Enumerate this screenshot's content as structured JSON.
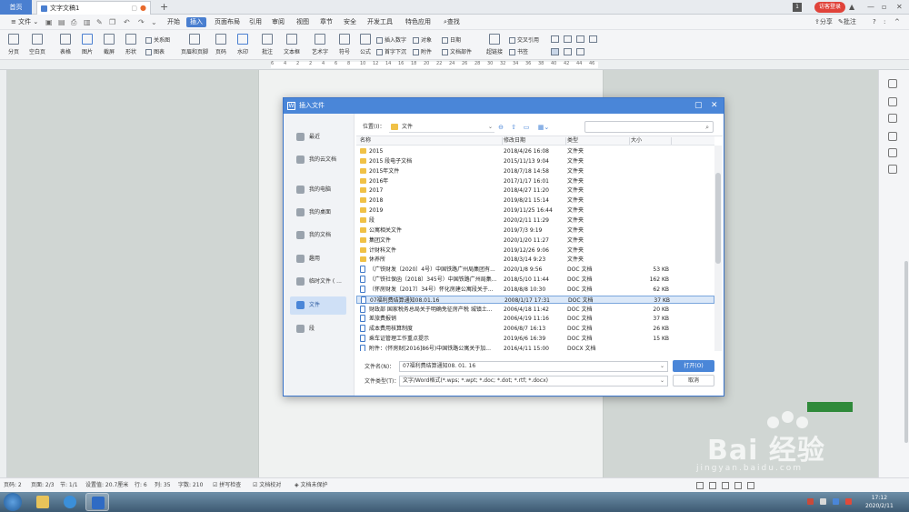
{
  "tabbar": {
    "home": "首页",
    "doc_tab": "文字文稿1",
    "new_tab": "+",
    "page_badge": "1",
    "login": "访客登录"
  },
  "menubar": {
    "file": "≡ 文件 ⌄",
    "menus": [
      "开始",
      "插入",
      "页面布局",
      "引用",
      "审阅",
      "视图",
      "章节",
      "安全",
      "开发工具",
      "特色应用",
      "查找"
    ],
    "active_menu": "插入",
    "share": "分享",
    "annotate": "批注",
    "help": "?",
    "more": ":",
    "collapse": "^"
  },
  "ribbon": {
    "items": [
      "分页",
      "空白页",
      "表格",
      "图片",
      "截屏",
      "形状",
      "关系图",
      "图表",
      "页眉和页脚",
      "页码",
      "水印",
      "批注",
      "文本框",
      "艺术字",
      "符号",
      "公式",
      "插入数字",
      "对象",
      "日期",
      "首字下沉",
      "附件",
      "文档部件",
      "超链接",
      "交叉引用",
      "书签"
    ]
  },
  "ruler": {
    "ticks": [
      "6",
      "4",
      "2",
      "2",
      "4",
      "6",
      "8",
      "10",
      "12",
      "14",
      "16",
      "18",
      "20",
      "22",
      "24",
      "26",
      "28",
      "30",
      "32",
      "34",
      "36",
      "38",
      "40",
      "42",
      "44",
      "46"
    ]
  },
  "dialog": {
    "title": "插入文件",
    "location_label": "位置(I)：",
    "location_value": "文件",
    "search_placeholder": "",
    "places": [
      "最近",
      "我的云文档",
      "我的电脑",
      "我的桌面",
      "我的文档",
      "趣用",
      "临时文件 ( ...",
      "文件",
      "段"
    ],
    "active_place": "文件",
    "columns": [
      "名称",
      "修改日期",
      "类型",
      "大小"
    ],
    "files": [
      {
        "name": "2015",
        "date": "2018/4/26 16:08",
        "type": "文件夹",
        "size": "",
        "kind": "folder"
      },
      {
        "name": "2015 段电子文档",
        "date": "2015/11/13 9:04",
        "type": "文件夹",
        "size": "",
        "kind": "folder"
      },
      {
        "name": "2015年文件",
        "date": "2018/7/18 14:58",
        "type": "文件夹",
        "size": "",
        "kind": "folder"
      },
      {
        "name": "2016年",
        "date": "2017/1/17 16:01",
        "type": "文件夹",
        "size": "",
        "kind": "folder"
      },
      {
        "name": "2017",
        "date": "2018/4/27 11:20",
        "type": "文件夹",
        "size": "",
        "kind": "folder"
      },
      {
        "name": "2018",
        "date": "2019/8/21 15:14",
        "type": "文件夹",
        "size": "",
        "kind": "folder"
      },
      {
        "name": "2019",
        "date": "2019/11/25 16:44",
        "type": "文件夹",
        "size": "",
        "kind": "folder"
      },
      {
        "name": "段",
        "date": "2020/2/11 11:29",
        "type": "文件夹",
        "size": "",
        "kind": "folder"
      },
      {
        "name": "公寓相关文件",
        "date": "2019/7/3 9:19",
        "type": "文件夹",
        "size": "",
        "kind": "folder"
      },
      {
        "name": "集团文件",
        "date": "2020/1/20 11:27",
        "type": "文件夹",
        "size": "",
        "kind": "folder"
      },
      {
        "name": "计财科文件",
        "date": "2019/12/26 9:06",
        "type": "文件夹",
        "size": "",
        "kind": "folder"
      },
      {
        "name": "休养所",
        "date": "2018/3/14 9:23",
        "type": "文件夹",
        "size": "",
        "kind": "folder"
      },
      {
        "name": "（广铁财发〔2020〕4号）中国铁路广州局集团有...",
        "date": "2020/1/8 9:56",
        "type": "DOC 文档",
        "size": "53 KB",
        "kind": "doc"
      },
      {
        "name": "（广铁社保函〔2018〕345号）中国铁路广州局集...",
        "date": "2018/5/10 11:44",
        "type": "DOC 文档",
        "size": "162 KB",
        "kind": "doc"
      },
      {
        "name": "（怀房财发〔2017〕34号）怀化房建公寓段关于...",
        "date": "2018/8/8 10:30",
        "type": "DOC 文档",
        "size": "62 KB",
        "kind": "doc"
      },
      {
        "name": "07福利费结算通知08.01.16",
        "date": "2008/1/17 17:31",
        "type": "DOC 文档",
        "size": "37 KB",
        "kind": "doc"
      },
      {
        "name": "财政部 国家税务总局关于明确免征房产税 城镇土...",
        "date": "2006/4/18 11:42",
        "type": "DOC 文档",
        "size": "20 KB",
        "kind": "doc"
      },
      {
        "name": "差旅费报销",
        "date": "2006/4/19 11:16",
        "type": "DOC 文档",
        "size": "37 KB",
        "kind": "doc"
      },
      {
        "name": "成本费用核算制度",
        "date": "2006/8/7 16:13",
        "type": "DOC 文档",
        "size": "26 KB",
        "kind": "doc"
      },
      {
        "name": "乘车证管理工作重点提示",
        "date": "2019/6/6 16:39",
        "type": "DOC 文档",
        "size": "15 KB",
        "kind": "doc"
      },
      {
        "name": "附件：(怀房财[2016]86号)中国铁路公寓关于加...",
        "date": "2016/4/11 15:00",
        "type": "DOCX 文档",
        "size": "",
        "kind": "doc"
      }
    ],
    "selected_file": "07福利费结算通知08.01.16",
    "filename_label": "文件名(N)：",
    "filename_value": "07福利费结算通知08. 01. 16",
    "filetype_label": "文件类型(T)：",
    "filetype_value": "文字/Word格式(*.wps; *.wpt; *.doc; *.dot; *.rtf; *.docx)",
    "open_button": "打开(O)",
    "cancel_button": "取消"
  },
  "statusbar": {
    "items": [
      "页码: 2",
      "页面: 2/3",
      "节: 1/1",
      "设置值: 20.7厘米",
      "行: 6",
      "列: 35",
      "字数: 210",
      "拼写检查",
      "文档校对",
      "文档未保护"
    ]
  },
  "taskbar": {
    "time": "17:12",
    "date": "2020/2/11"
  },
  "watermark": {
    "brand": "Bai 经验",
    "url": "jingyan.baidu.com"
  },
  "colors": {
    "accent": "#4a86d8",
    "selection": "#dbe8f8",
    "folder": "#f0c146",
    "login": "#e0433a"
  }
}
